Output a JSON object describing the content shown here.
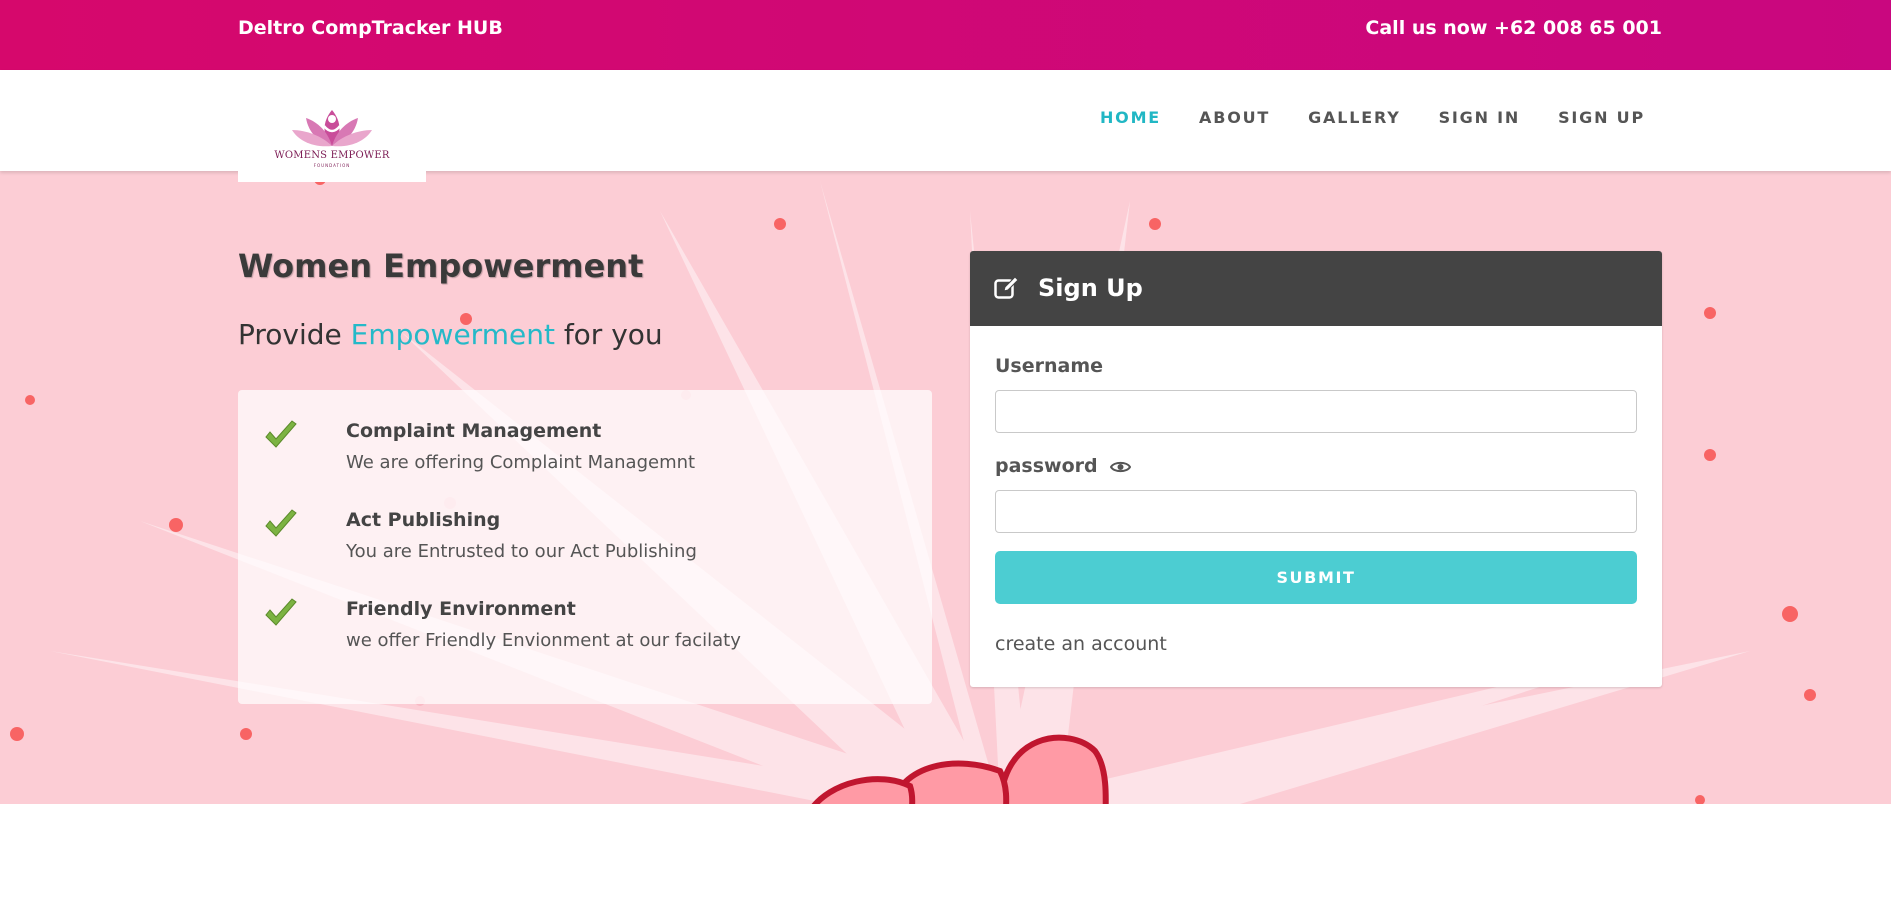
{
  "topbar": {
    "brand": "Deltro CompTracker HUB",
    "phone": "Call us now +62 008 65 001"
  },
  "logo": {
    "name": "WOMENS EMPOWER",
    "subtitle": "FOUNDATION"
  },
  "nav": {
    "items": [
      {
        "label": "HOME",
        "active": true
      },
      {
        "label": "ABOUT",
        "active": false
      },
      {
        "label": "GALLERY",
        "active": false
      },
      {
        "label": "SIGN IN",
        "active": false
      },
      {
        "label": "SIGN UP",
        "active": false
      }
    ]
  },
  "hero": {
    "headline": "Women Empowerment",
    "tagline_pre": "Provide ",
    "tagline_accent": "Empowerment",
    "tagline_post": " for you",
    "features": [
      {
        "title": "Complaint Management",
        "desc": "We are offering Complaint Managemnt"
      },
      {
        "title": "Act Publishing",
        "desc": "You are Entrusted to our Act Publishing"
      },
      {
        "title": "Friendly Environment",
        "desc": "we offer Friendly Envionment at our facilaty"
      }
    ]
  },
  "signup": {
    "title": "Sign Up",
    "username_label": "Username",
    "username_value": "",
    "password_label": "password",
    "password_value": "",
    "submit_label": "SUBMIT",
    "create_account": "create an account"
  },
  "colors": {
    "topbar": "#d6086c",
    "accent": "#21b7c4",
    "hero_bg": "#fccdd5",
    "panel_header": "#444444",
    "submit": "#4ccdd2",
    "check": "#7cb342"
  }
}
